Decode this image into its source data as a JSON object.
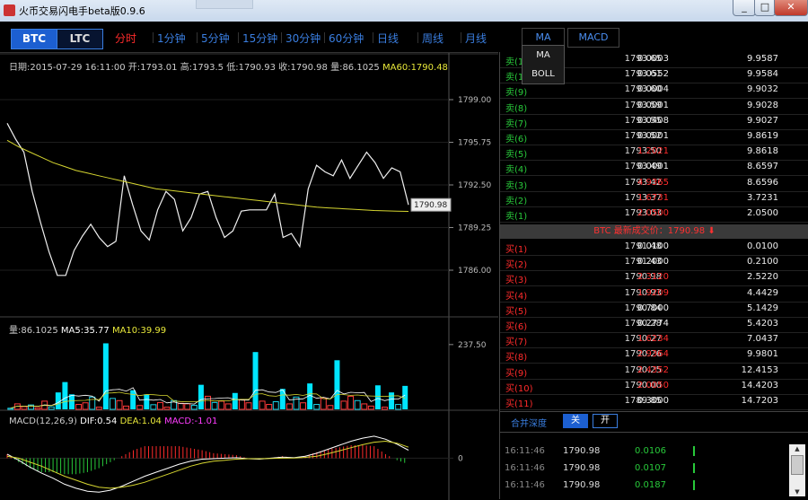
{
  "window": {
    "title": "火币交易闪电手beta版0.9.6",
    "min_label": "_",
    "max_label": "□",
    "close_label": "✕"
  },
  "toolbar": {
    "coins": [
      "BTC",
      "LTC"
    ],
    "periods": [
      "分时",
      "1分钟",
      "5分钟",
      "15分钟",
      "30分钟",
      "60分钟",
      "日线",
      "周线",
      "月线"
    ],
    "active_period": "分时",
    "indicator_tabs": [
      "MA",
      "MACD"
    ],
    "indicator_dropdown": [
      "MA",
      "BOLL"
    ]
  },
  "price_info": {
    "date_label": "日期:2015-07-29 16:11:00",
    "open_label": "开:1793.01",
    "high_label": "高:1793.5",
    "low_label": "低:1790.93",
    "close_label": "收:1790.98",
    "volume_label": "量:86.1025",
    "ma60_label": "MA60:1790.48"
  },
  "volume_info": {
    "vol_label": "量:86.1025",
    "ma5_label": "MA5:35.77",
    "ma10_label": "MA10:39.99"
  },
  "macd_info": {
    "title_label": "MACD(12,26,9)",
    "dif_label": "DIF:0.54",
    "dea_label": "DEA:1.04",
    "macd_label": "MACD:-1.01"
  },
  "colors": {
    "up": "#ff2b2b",
    "down": "#28c93a",
    "accent": "#3a7ee0",
    "ma60": "#d6d630",
    "volume_bar": "#00e5ff",
    "macd_dif": "#ffffff",
    "macd_dea": "#d6d630"
  },
  "chart_data": [
    {
      "type": "line",
      "name": "price",
      "y_ticks": [
        "1799.00",
        "1795.75",
        "1792.50",
        "1789.25",
        "1786.00"
      ],
      "ylim": [
        1786.0,
        1799.0
      ],
      "current_price_label": "1790.98",
      "series": [
        {
          "name": "price",
          "values": [
            1797.2,
            1796.0,
            1795.0,
            1792.0,
            1789.6,
            1787.4,
            1785.6,
            1785.6,
            1787.5,
            1788.6,
            1789.5,
            1788.5,
            1787.8,
            1788.2,
            1793.2,
            1791.0,
            1789.0,
            1788.3,
            1790.6,
            1792.0,
            1791.4,
            1789.0,
            1790.0,
            1791.8,
            1792.0,
            1790.0,
            1788.5,
            1789.0,
            1790.5,
            1790.6,
            1790.6,
            1790.6,
            1791.8,
            1788.5,
            1788.8,
            1787.8,
            1792.2,
            1794.0,
            1793.5,
            1793.2,
            1794.4,
            1793.0,
            1794.0,
            1795.0,
            1794.2,
            1793.0,
            1793.8,
            1793.5,
            1790.98
          ]
        },
        {
          "name": "MA60",
          "values": [
            1795.9,
            1795.4,
            1795.0,
            1794.6,
            1794.2,
            1793.9,
            1793.6,
            1793.4,
            1793.2,
            1793.0,
            1792.8,
            1792.6,
            1792.4,
            1792.2,
            1792.1,
            1792.0,
            1791.9,
            1791.8,
            1791.7,
            1791.6,
            1791.5,
            1791.4,
            1791.3,
            1791.2,
            1791.1,
            1791.0,
            1790.9,
            1790.8,
            1790.75,
            1790.7,
            1790.65,
            1790.6,
            1790.55,
            1790.52,
            1790.5,
            1790.48
          ]
        }
      ]
    },
    {
      "type": "bar",
      "name": "volume",
      "y_ticks": [
        "237.50"
      ],
      "ylim": [
        0,
        260
      ],
      "values": [
        4,
        20,
        10,
        16,
        6,
        30,
        9,
        62,
        100,
        55,
        18,
        24,
        45,
        8,
        242,
        40,
        32,
        12,
        70,
        14,
        55,
        17,
        25,
        8,
        32,
        22,
        20,
        15,
        90,
        48,
        25,
        30,
        20,
        60,
        35,
        24,
        210,
        30,
        18,
        28,
        75,
        20,
        45,
        24,
        95,
        18,
        40,
        14,
        180,
        30,
        48,
        32,
        20,
        12,
        88,
        8,
        62,
        18,
        86
      ]
    },
    {
      "type": "line",
      "name": "MACD",
      "y_ticks": [
        "0"
      ],
      "ylim": [
        -4,
        3
      ],
      "series": [
        {
          "name": "DIF",
          "values": [
            0.4,
            -0.2,
            -0.9,
            -1.5,
            -2.0,
            -2.6,
            -3.0,
            -3.3,
            -3.4,
            -3.2,
            -2.8,
            -2.3,
            -1.8,
            -1.4,
            -1.0,
            -0.6,
            -0.3,
            -0.1,
            -0.05,
            0.0,
            0.05,
            -0.05,
            -0.1,
            0.0,
            0.1,
            0.05,
            0.2,
            0.5,
            0.9,
            1.3,
            1.7,
            2.0,
            2.2,
            1.9,
            1.4,
            0.8
          ]
        },
        {
          "name": "DEA",
          "values": [
            0.2,
            0.0,
            -0.4,
            -0.8,
            -1.3,
            -1.8,
            -2.2,
            -2.6,
            -2.9,
            -3.0,
            -2.9,
            -2.7,
            -2.4,
            -2.0,
            -1.6,
            -1.2,
            -0.8,
            -0.5,
            -0.3,
            -0.2,
            -0.1,
            -0.05,
            -0.05,
            -0.02,
            0.0,
            0.02,
            0.08,
            0.2,
            0.45,
            0.75,
            1.05,
            1.35,
            1.6,
            1.7,
            1.5,
            1.1
          ]
        }
      ]
    }
  ],
  "orderbook": {
    "sells": [
      {
        "label": "卖(12)",
        "price": "1793.65",
        "amount": "0.0003",
        "total": "9.9587",
        "amount_color": "white"
      },
      {
        "label": "卖(11)",
        "price": "1793.61",
        "amount": "0.0552",
        "total": "9.9584",
        "amount_color": "white"
      },
      {
        "label": "卖(9)",
        "price": "1793.60",
        "amount": "0.0004",
        "total": "9.9032",
        "amount_color": "white"
      },
      {
        "label": "卖(8)",
        "price": "1793.59",
        "amount": "0.0001",
        "total": "9.9028",
        "amount_color": "white"
      },
      {
        "label": "卖(7)",
        "price": "1793.55",
        "amount": "0.0408",
        "total": "9.9027",
        "amount_color": "white"
      },
      {
        "label": "卖(6)",
        "price": "1793.52",
        "amount": "0.0001",
        "total": "9.8619",
        "amount_color": "white"
      },
      {
        "label": "卖(5)",
        "price": "1793.50",
        "amount": "1.2021",
        "total": "9.8618",
        "amount_color": "red"
      },
      {
        "label": "卖(4)",
        "price": "1793.49",
        "amount": "0.0001",
        "total": "8.6597",
        "amount_color": "white"
      },
      {
        "label": "卖(3)",
        "price": "1793.42",
        "amount": "4.9365",
        "total": "8.6596",
        "amount_color": "red"
      },
      {
        "label": "卖(2)",
        "price": "1793.37",
        "amount": "1.6731",
        "total": "3.7231",
        "amount_color": "red"
      },
      {
        "label": "卖(1)",
        "price": "1793.03",
        "amount": "2.0500",
        "total": "2.0500",
        "amount_color": "red"
      }
    ],
    "last_price": "BTC 最新成交价：1790.98 ⬇",
    "buys": [
      {
        "label": "买(1)",
        "price": "1791.48",
        "amount": "0.0100",
        "total": "0.0100",
        "amount_color": "white"
      },
      {
        "label": "买(2)",
        "price": "1791.43",
        "amount": "0.2000",
        "total": "0.2100",
        "amount_color": "white"
      },
      {
        "label": "买(3)",
        "price": "1790.98",
        "amount": "2.3120",
        "total": "2.5220",
        "amount_color": "red"
      },
      {
        "label": "买(4)",
        "price": "1790.93",
        "amount": "1.9209",
        "total": "4.4429",
        "amount_color": "red"
      },
      {
        "label": "买(5)",
        "price": "1790.84",
        "amount": "0.7000",
        "total": "5.1429",
        "amount_color": "white"
      },
      {
        "label": "买(6)",
        "price": "1790.28",
        "amount": "0.2774",
        "total": "5.4203",
        "amount_color": "white"
      },
      {
        "label": "买(7)",
        "price": "1790.27",
        "amount": "1.6234",
        "total": "7.0437",
        "amount_color": "red"
      },
      {
        "label": "买(8)",
        "price": "1790.26",
        "amount": "2.9364",
        "total": "9.9801",
        "amount_color": "red"
      },
      {
        "label": "买(9)",
        "price": "1790.25",
        "amount": "2.4352",
        "total": "12.4153",
        "amount_color": "red"
      },
      {
        "label": "买(10)",
        "price": "1790.00",
        "amount": "2.0050",
        "total": "14.4203",
        "amount_color": "red"
      },
      {
        "label": "买(11)",
        "price": "1789.85",
        "amount": "0.3000",
        "total": "14.7203",
        "amount_color": "white"
      }
    ]
  },
  "depth": {
    "label": "合并深度",
    "off": "关",
    "on": "开"
  },
  "trades": [
    {
      "time": "16:11:46",
      "price": "1790.98",
      "amount": "0.0106"
    },
    {
      "time": "16:11:46",
      "price": "1790.98",
      "amount": "0.0107"
    },
    {
      "time": "16:11:46",
      "price": "1790.98",
      "amount": "0.0187"
    }
  ]
}
